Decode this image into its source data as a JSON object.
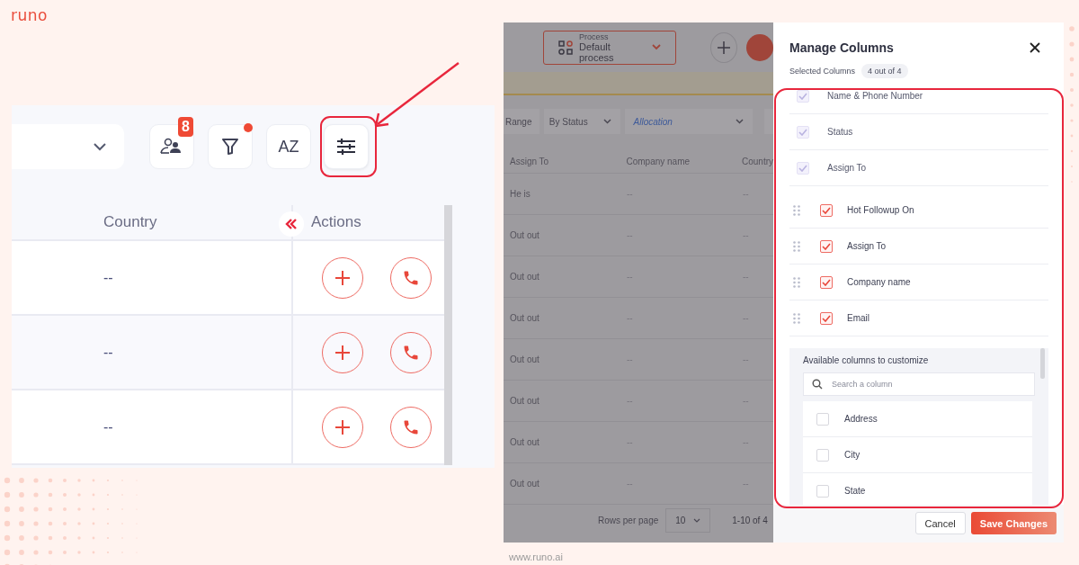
{
  "logo": "runo",
  "toolbar": {
    "badge": "8",
    "filter_active": true,
    "sort_label": "AZ"
  },
  "table": {
    "columns": [
      "Country",
      "Actions"
    ],
    "rows": [
      {
        "country": "--"
      },
      {
        "country": "--"
      },
      {
        "country": "--"
      }
    ]
  },
  "app": {
    "process_label": "Process",
    "process_value": "Default process",
    "filters": [
      {
        "label": "Range",
        "kind": "button"
      },
      {
        "label": "By Status",
        "kind": "select"
      },
      {
        "label": "Allocation",
        "kind": "input"
      }
    ],
    "columns": [
      "Assign To",
      "Company name",
      "Country"
    ],
    "rows": [
      {
        "assign_to": "He is",
        "company": "--",
        "country": "--"
      },
      {
        "assign_to": "Out out",
        "company": "--",
        "country": "--"
      },
      {
        "assign_to": "Out out",
        "company": "--",
        "country": "--"
      },
      {
        "assign_to": "Out out",
        "company": "--",
        "country": "--"
      },
      {
        "assign_to": "Out out",
        "company": "--",
        "country": "--"
      },
      {
        "assign_to": "Out out",
        "company": "--",
        "country": "--"
      },
      {
        "assign_to": "Out out",
        "company": "--",
        "country": "--"
      },
      {
        "assign_to": "Out out",
        "company": "--",
        "country": "--"
      }
    ],
    "rows_per_page_label": "Rows per page",
    "rows_per_page": "10",
    "range": "1-10 of 4"
  },
  "panel": {
    "title": "Manage Columns",
    "selected_label": "Selected Columns",
    "selected_count": "4 out of 4",
    "selected_columns": [
      {
        "label": "Name & Phone Number",
        "checked": true,
        "locked": true
      },
      {
        "label": "Status",
        "checked": true,
        "locked": true
      },
      {
        "label": "Assign To",
        "checked": true,
        "locked": true
      },
      {
        "label": "Hot Followup On",
        "checked": true,
        "locked": false
      },
      {
        "label": "Assign To",
        "checked": true,
        "locked": false
      },
      {
        "label": "Company name",
        "checked": true,
        "locked": false
      },
      {
        "label": "Email",
        "checked": true,
        "locked": false
      }
    ],
    "available_title": "Available columns to customize",
    "search": {
      "placeholder": "Search a column"
    },
    "available_columns": [
      {
        "label": "Address",
        "checked": false
      },
      {
        "label": "City",
        "checked": false
      },
      {
        "label": "State",
        "checked": false
      }
    ],
    "buttons": [
      {
        "label": "Cancel",
        "kind": "secondary"
      },
      {
        "label": "Save Changes",
        "kind": "primary"
      }
    ]
  },
  "footer": "www.runo.ai"
}
